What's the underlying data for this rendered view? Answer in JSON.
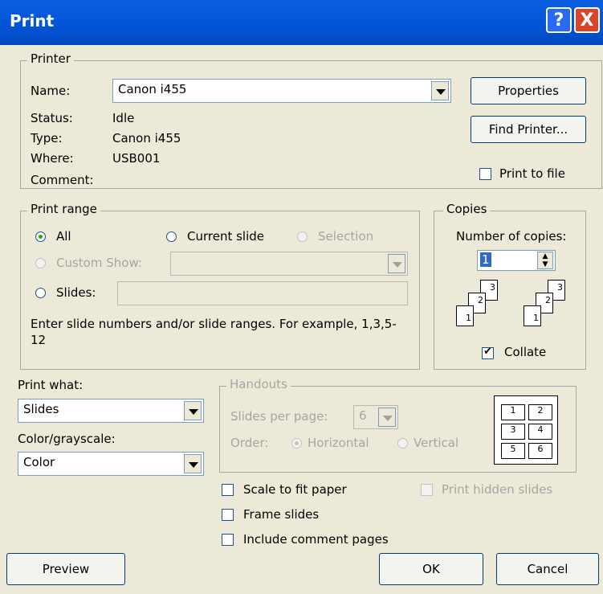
{
  "window": {
    "title": "Print",
    "help_glyph": "?",
    "close_glyph": "X"
  },
  "printer": {
    "legend": "Printer",
    "name_label": "Name:",
    "name_value": "Canon i455",
    "status_label": "Status:",
    "status_value": "Idle",
    "type_label": "Type:",
    "type_value": "Canon i455",
    "where_label": "Where:",
    "where_value": "USB001",
    "comment_label": "Comment:",
    "properties_btn": "Properties",
    "find_btn": "Find Printer...",
    "print_to_file": "Print to file"
  },
  "range": {
    "legend": "Print range",
    "all": "All",
    "current": "Current slide",
    "selection": "Selection",
    "custom": "Custom Show:",
    "slides": "Slides:",
    "hint": "Enter slide numbers and/or slide ranges. For example, 1,3,5-12"
  },
  "copies": {
    "legend": "Copies",
    "label": "Number of copies:",
    "value": "1",
    "collate": "Collate",
    "stack_numbers": [
      "3",
      "2",
      "1"
    ]
  },
  "print_what": {
    "label": "Print what:",
    "value": "Slides"
  },
  "color": {
    "label": "Color/grayscale:",
    "value": "Color"
  },
  "handouts": {
    "legend": "Handouts",
    "per_page_label": "Slides per page:",
    "per_page_value": "6",
    "order_label": "Order:",
    "horizontal": "Horizontal",
    "vertical": "Vertical",
    "grid_numbers": [
      "1",
      "2",
      "3",
      "4",
      "5",
      "6"
    ]
  },
  "options": {
    "scale": "Scale to fit paper",
    "frame": "Frame slides",
    "comments": "Include comment pages",
    "hidden": "Print hidden slides"
  },
  "buttons": {
    "preview": "Preview",
    "ok": "OK",
    "cancel": "Cancel"
  }
}
